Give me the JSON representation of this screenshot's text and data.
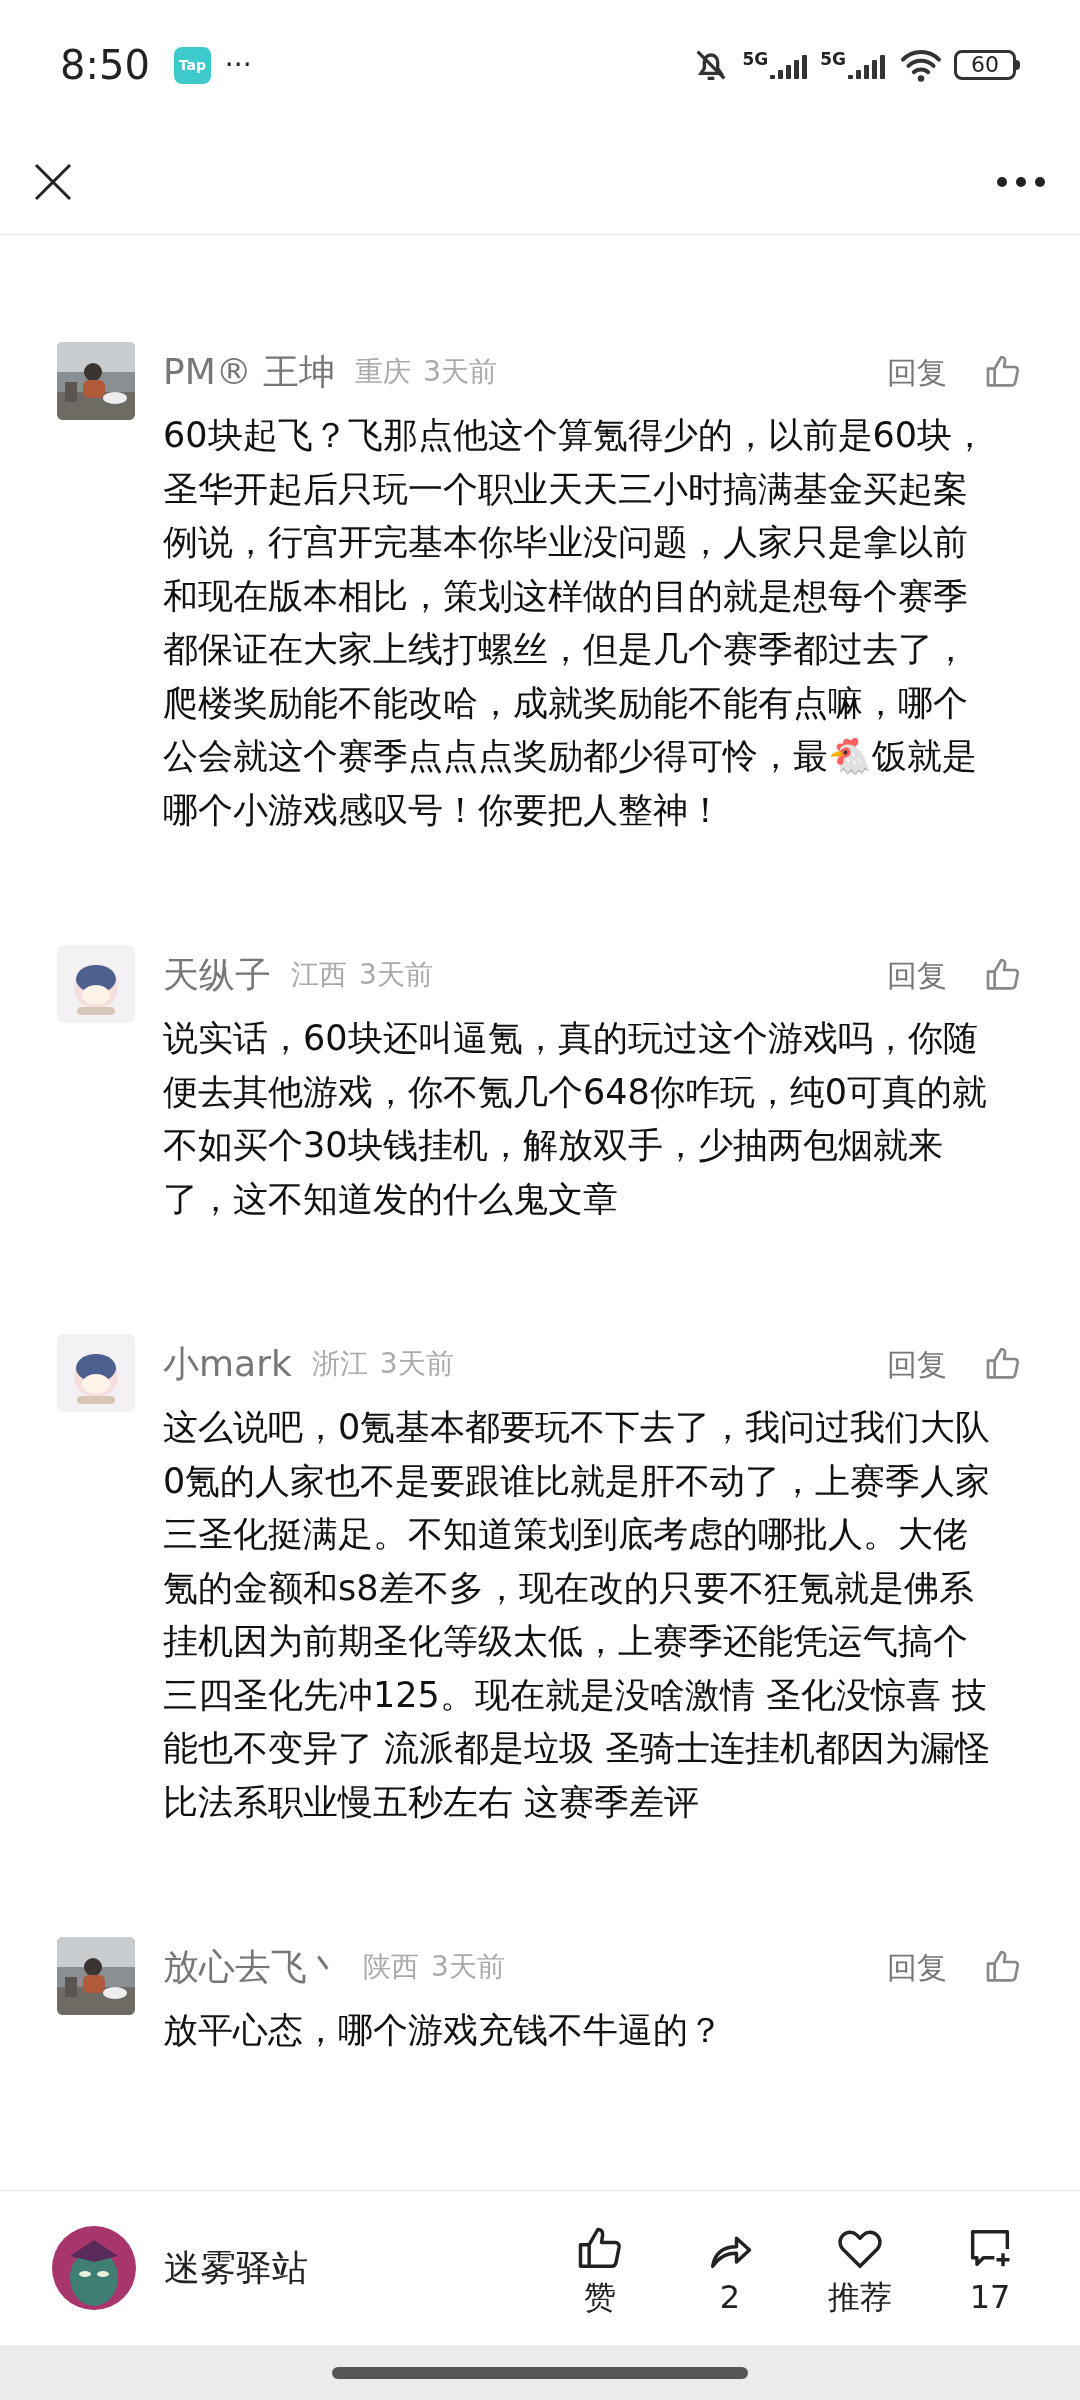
{
  "status_bar": {
    "time": "8:50",
    "app_badge": "Tap",
    "more": "···",
    "network_1": "5G",
    "network_2": "5G",
    "battery": "60"
  },
  "comments": [
    {
      "author": "PM® 王坤",
      "region": "重庆",
      "time": "3天前",
      "reply": "回复",
      "text": "60块起飞？飞那点他这个算氪得少的，以前是60块，圣华开起后只玩一个职业天天三小时搞满基金买起案例说，行宫开完基本你毕业没问题，人家只是拿以前和现在版本相比，策划这样做的目的就是想每个赛季都保证在大家上线打螺丝，但是几个赛季都过去了，爬楼奖励能不能改哈，成就奖励能不能有点嘛，哪个公会就这个赛季点点点奖励都少得可怜，最🐔饭就是哪个小游戏感叹号！你要把人整神！"
    },
    {
      "author": "天纵子",
      "region": "江西",
      "time": "3天前",
      "reply": "回复",
      "text": "说实话，60块还叫逼氪，真的玩过这个游戏吗，你随便去其他游戏，你不氪几个648你咋玩，纯0可真的就不如买个30块钱挂机，解放双手，少抽两包烟就来了，这不知道发的什么鬼文章"
    },
    {
      "author": "小mark",
      "region": "浙江",
      "time": "3天前",
      "reply": "回复",
      "text": "这么说吧，0氪基本都要玩不下去了，我问过我们大队0氪的人家也不是要跟谁比就是肝不动了，上赛季人家三圣化挺满足。不知道策划到底考虑的哪批人。大佬氪的金额和s8差不多，现在改的只要不狂氪就是佛系挂机因为前期圣化等级太低，上赛季还能凭运气搞个三四圣化先冲125。现在就是没啥激情 圣化没惊喜 技能也不变异了 流派都是垃圾 圣骑士连挂机都因为漏怪比法系职业慢五秒左右 这赛季差评"
    },
    {
      "author": "放心去飞丶",
      "region": "陕西",
      "time": "3天前",
      "reply": "回复",
      "text": "放平心态，哪个游戏充钱不牛逼的？"
    }
  ],
  "bottom_bar": {
    "channel": "迷雾驿站",
    "actions": [
      {
        "kind": "like",
        "label": "赞"
      },
      {
        "kind": "share",
        "label": "2"
      },
      {
        "kind": "recommend",
        "label": "推荐"
      },
      {
        "kind": "comment",
        "label": "17"
      }
    ]
  }
}
